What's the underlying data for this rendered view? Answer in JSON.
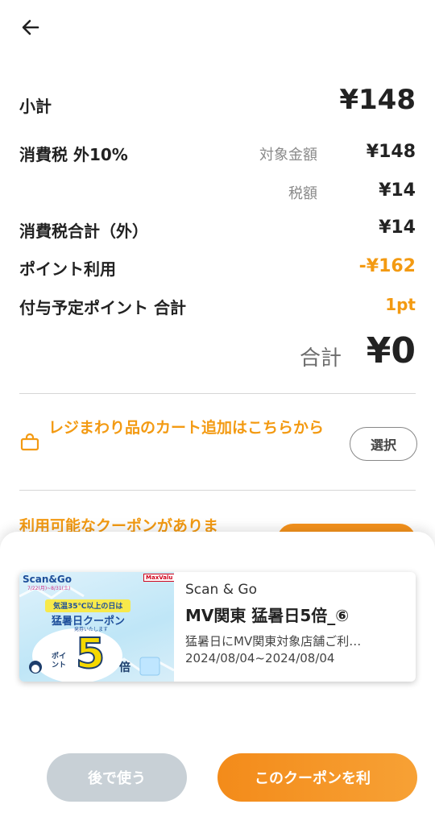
{
  "header": {
    "back_icon": "arrow-left-icon"
  },
  "summary": {
    "subtotal_label": "小計",
    "subtotal_value": "¥148",
    "tax_label": "消費税 外10%",
    "tax_target_label": "対象金額",
    "tax_target_value": "¥148",
    "tax_amount_label": "税額",
    "tax_amount_value": "¥14",
    "tax_total_label": "消費税合計（外）",
    "tax_total_value": "¥14",
    "points_used_label": "ポイント利用",
    "points_used_value": "-¥162",
    "points_grant_label": "付与予定ポイント 合計",
    "points_grant_value": "1pt",
    "total_label": "合計",
    "total_value": "¥0"
  },
  "cart": {
    "icon": "shopping-bag-icon",
    "link_text": "レジまわり品のカート追加はこちらから",
    "select_label": "選択"
  },
  "coupon_notice": {
    "text": "利用可能なクーポンがありま"
  },
  "sheet": {
    "coupon": {
      "image": {
        "logo_text": "Scan&Go",
        "period_text": "7/22(月)~8/31(土)",
        "brand_logo": "MaxValu",
        "condition_text": "気温35℃以上の日は",
        "title_text": "猛暑日クーポン",
        "issue_text": "発券いたします",
        "point_label": "ポイント",
        "multiplier": "5",
        "times_label": "倍"
      },
      "brand": "Scan & Go",
      "title": "MV関東 猛暑日5倍_⑥",
      "description": "猛暑日にMV関東対象店舗ご利…",
      "date_range": "2024/08/04~2024/08/04"
    },
    "later_button": "後で使う",
    "use_button": "このクーポンを利"
  },
  "colors": {
    "accent": "#f39a12",
    "button_gray": "#c8d0d6",
    "text_dark": "#222222",
    "text_gray": "#8a8a8a"
  }
}
